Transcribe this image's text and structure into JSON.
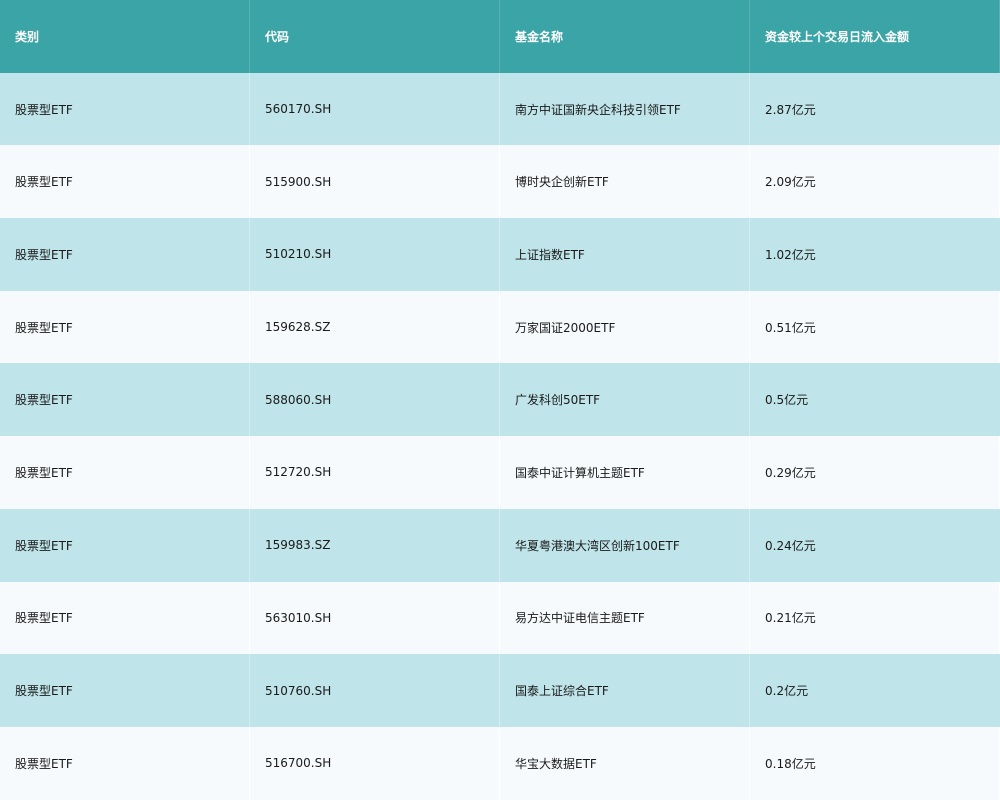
{
  "table": {
    "headers": [
      "类别",
      "代码",
      "基金名称",
      "资金较上个交易日流入金额"
    ],
    "rows": [
      [
        "股票型ETF",
        "560170.SH",
        "南方中证国新央企科技引领ETF",
        "2.87亿元"
      ],
      [
        "股票型ETF",
        "515900.SH",
        "博时央企创新ETF",
        "2.09亿元"
      ],
      [
        "股票型ETF",
        "510210.SH",
        "上证指数ETF",
        "1.02亿元"
      ],
      [
        "股票型ETF",
        "159628.SZ",
        "万家国证2000ETF",
        "0.51亿元"
      ],
      [
        "股票型ETF",
        "588060.SH",
        "广发科创50ETF",
        "0.5亿元"
      ],
      [
        "股票型ETF",
        "512720.SH",
        "国泰中证计算机主题ETF",
        "0.29亿元"
      ],
      [
        "股票型ETF",
        "159983.SZ",
        "华夏粤港澳大湾区创新100ETF",
        "0.24亿元"
      ],
      [
        "股票型ETF",
        "563010.SH",
        "易方达中证电信主题ETF",
        "0.21亿元"
      ],
      [
        "股票型ETF",
        "510760.SH",
        "国泰上证综合ETF",
        "0.2亿元"
      ],
      [
        "股票型ETF",
        "516700.SH",
        "华宝大数据ETF",
        "0.18亿元"
      ]
    ]
  },
  "colors": {
    "header_bg": "#3ba4a6",
    "row_odd_bg": "#bfe4e9",
    "row_even_bg": "#f7fafc"
  }
}
